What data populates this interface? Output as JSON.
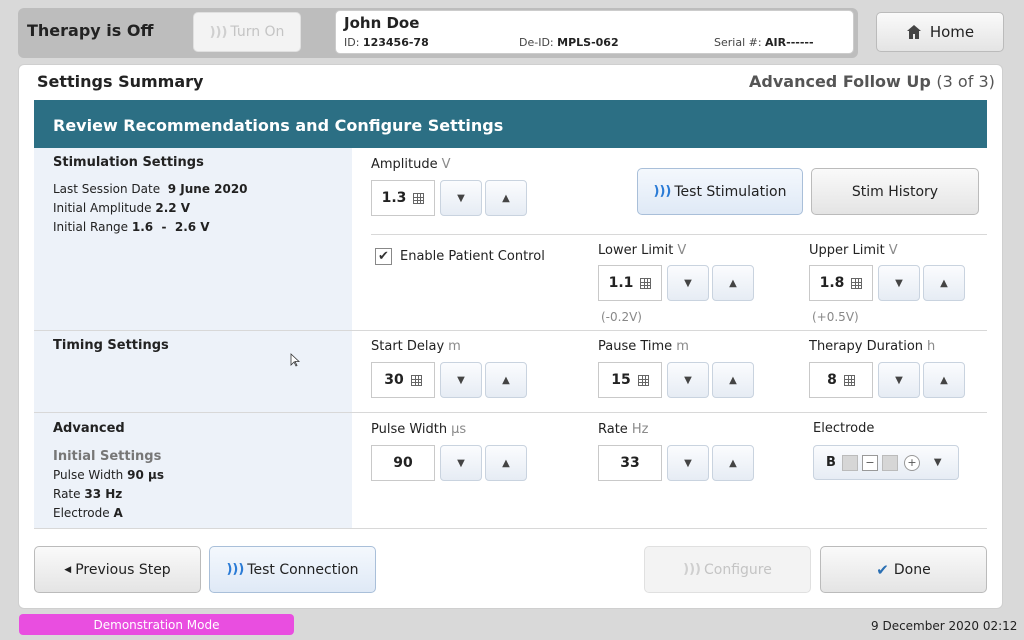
{
  "header": {
    "therapy_status": "Therapy is Off",
    "turn_on_label": "Turn On",
    "patient": {
      "name": "John Doe",
      "id_label": "ID:",
      "id_value": "123456-78",
      "deid_label": "De-ID:",
      "deid_value": "MPLS-062",
      "serial_label": "Serial #:",
      "serial_value": "AIR------"
    },
    "home_label": "Home"
  },
  "page": {
    "title": "Settings Summary",
    "step_title": "Advanced Follow Up",
    "step_progress": "(3 of 3)",
    "banner": "Review Recommendations and Configure Settings"
  },
  "stimulation": {
    "section_title": "Stimulation Settings",
    "last_session_label": "Last Session Date",
    "last_session_value": "9 June 2020",
    "initial_amplitude_label": "Initial Amplitude",
    "initial_amplitude_value": "2.2 V",
    "initial_range_label": "Initial Range",
    "initial_range_value": "1.6  -  2.6 V",
    "amplitude": {
      "label": "Amplitude",
      "unit": "V",
      "value": "1.3"
    },
    "test_stim_label": "Test Stimulation",
    "stim_history_label": "Stim History",
    "enable_patient_control_label": "Enable Patient Control",
    "enable_patient_control": true,
    "lower_limit": {
      "label": "Lower Limit",
      "unit": "V",
      "value": "1.1",
      "hint": "(-0.2V)"
    },
    "upper_limit": {
      "label": "Upper Limit",
      "unit": "V",
      "value": "1.8",
      "hint": "(+0.5V)"
    }
  },
  "timing": {
    "section_title": "Timing Settings",
    "start_delay": {
      "label": "Start Delay",
      "unit": "m",
      "value": "30"
    },
    "pause_time": {
      "label": "Pause Time",
      "unit": "m",
      "value": "15"
    },
    "therapy_duration": {
      "label": "Therapy Duration",
      "unit": "h",
      "value": "8"
    }
  },
  "advanced": {
    "section_title": "Advanced",
    "initial_settings_label": "Initial Settings",
    "pulse_width_init_label": "Pulse Width",
    "pulse_width_init_value": "90 µs",
    "rate_init_label": "Rate",
    "rate_init_value": "33 Hz",
    "electrode_init_label": "Electrode",
    "electrode_init_value": "A",
    "pulse_width": {
      "label": "Pulse Width",
      "unit": "µs",
      "value": "90"
    },
    "rate": {
      "label": "Rate",
      "unit": "Hz",
      "value": "33"
    },
    "electrode": {
      "label": "Electrode",
      "value": "B"
    }
  },
  "footer": {
    "previous_label": "Previous Step",
    "test_connection_label": "Test Connection",
    "configure_label": "Configure",
    "done_label": "Done",
    "demo_mode": "Demonstration Mode",
    "datetime": "9 December 2020 02:12"
  },
  "colors": {
    "banner": "#2c6f84",
    "demo": "#e94ee0",
    "accent": "#2a7bd6"
  },
  "icons": [
    "signal-icon",
    "home-icon",
    "keypad-icon",
    "arrow-down-icon",
    "arrow-up-icon",
    "checkmark-icon",
    "triangle-left-icon",
    "chevron-down-icon",
    "cursor-icon"
  ]
}
